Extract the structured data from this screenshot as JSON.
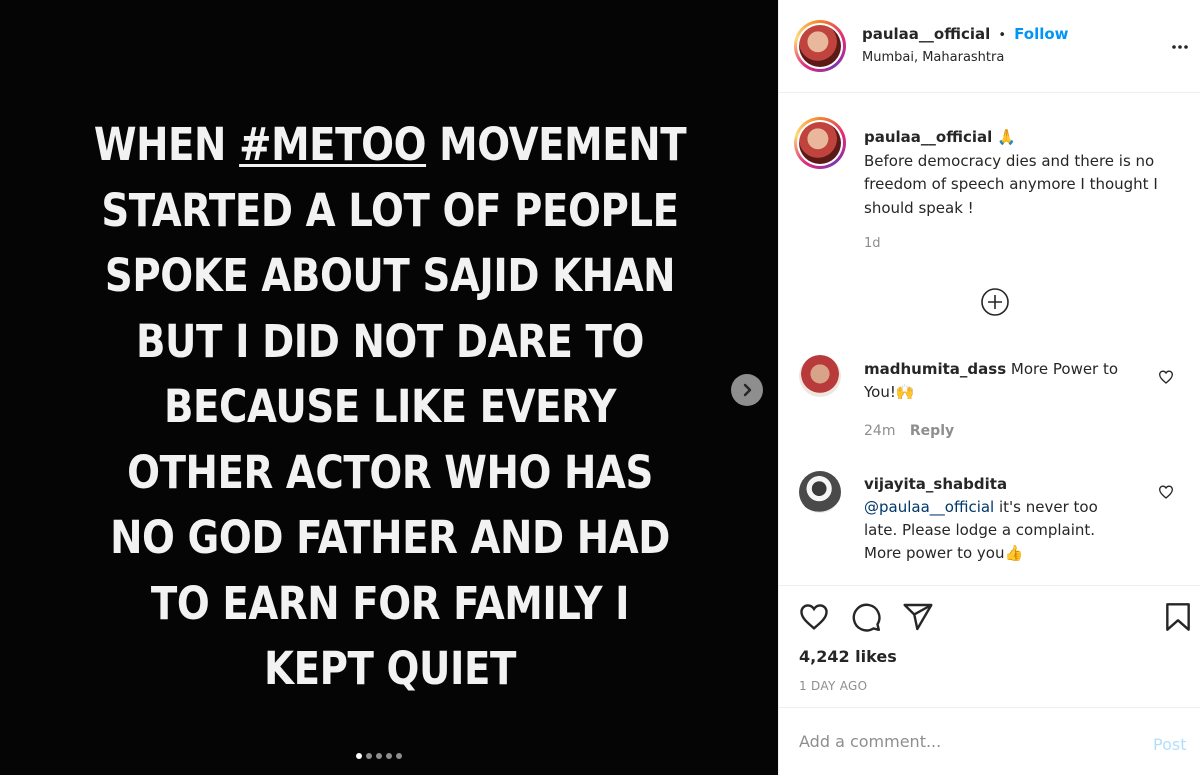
{
  "media": {
    "lines_before_tag": "WHEN ",
    "hashtag": "#METOO",
    "line1_after": " MOVEMENT",
    "lines": [
      "STARTED A LOT OF PEOPLE",
      "SPOKE ABOUT SAJID KHAN",
      "BUT I DID NOT DARE TO",
      "BECAUSE LIKE EVERY",
      "OTHER ACTOR WHO HAS",
      "NO GOD FATHER AND HAD",
      "TO EARN FOR FAMILY I",
      "KEPT QUIET"
    ],
    "slide_count": 5,
    "active_slide": 1,
    "next_icon": "chevron-right-icon"
  },
  "header": {
    "username": "paulaa__official",
    "separator": "•",
    "follow_label": "Follow",
    "location": "Mumbai, Maharashtra",
    "more_icon": "more-horizontal-icon"
  },
  "caption": {
    "username": "paulaa__official",
    "emoji": "🙏",
    "text": "Before democracy dies and there is no freedom of speech anymore I thought I should speak !",
    "time": "1d"
  },
  "load_more_icon": "plus-circle-icon",
  "comments": [
    {
      "username": "madhumita_dass",
      "text": "More Power to You!🙌",
      "time": "24m",
      "reply_label": "Reply"
    },
    {
      "username": "vijayita_shabdita",
      "mention": "@paulaa__official",
      "text": " it's never too late. Please lodge a complaint. More power to you👍"
    }
  ],
  "actions": {
    "likes": "4,242 likes",
    "date": "1 DAY AGO",
    "icons": [
      "heart-icon",
      "comment-icon",
      "share-icon",
      "bookmark-icon"
    ]
  },
  "add_comment": {
    "placeholder": "Add a comment...",
    "post_label": "Post"
  },
  "colors": {
    "accent": "#0095f6",
    "post_disabled": "#b2dffc",
    "media_bg": "#050505"
  }
}
